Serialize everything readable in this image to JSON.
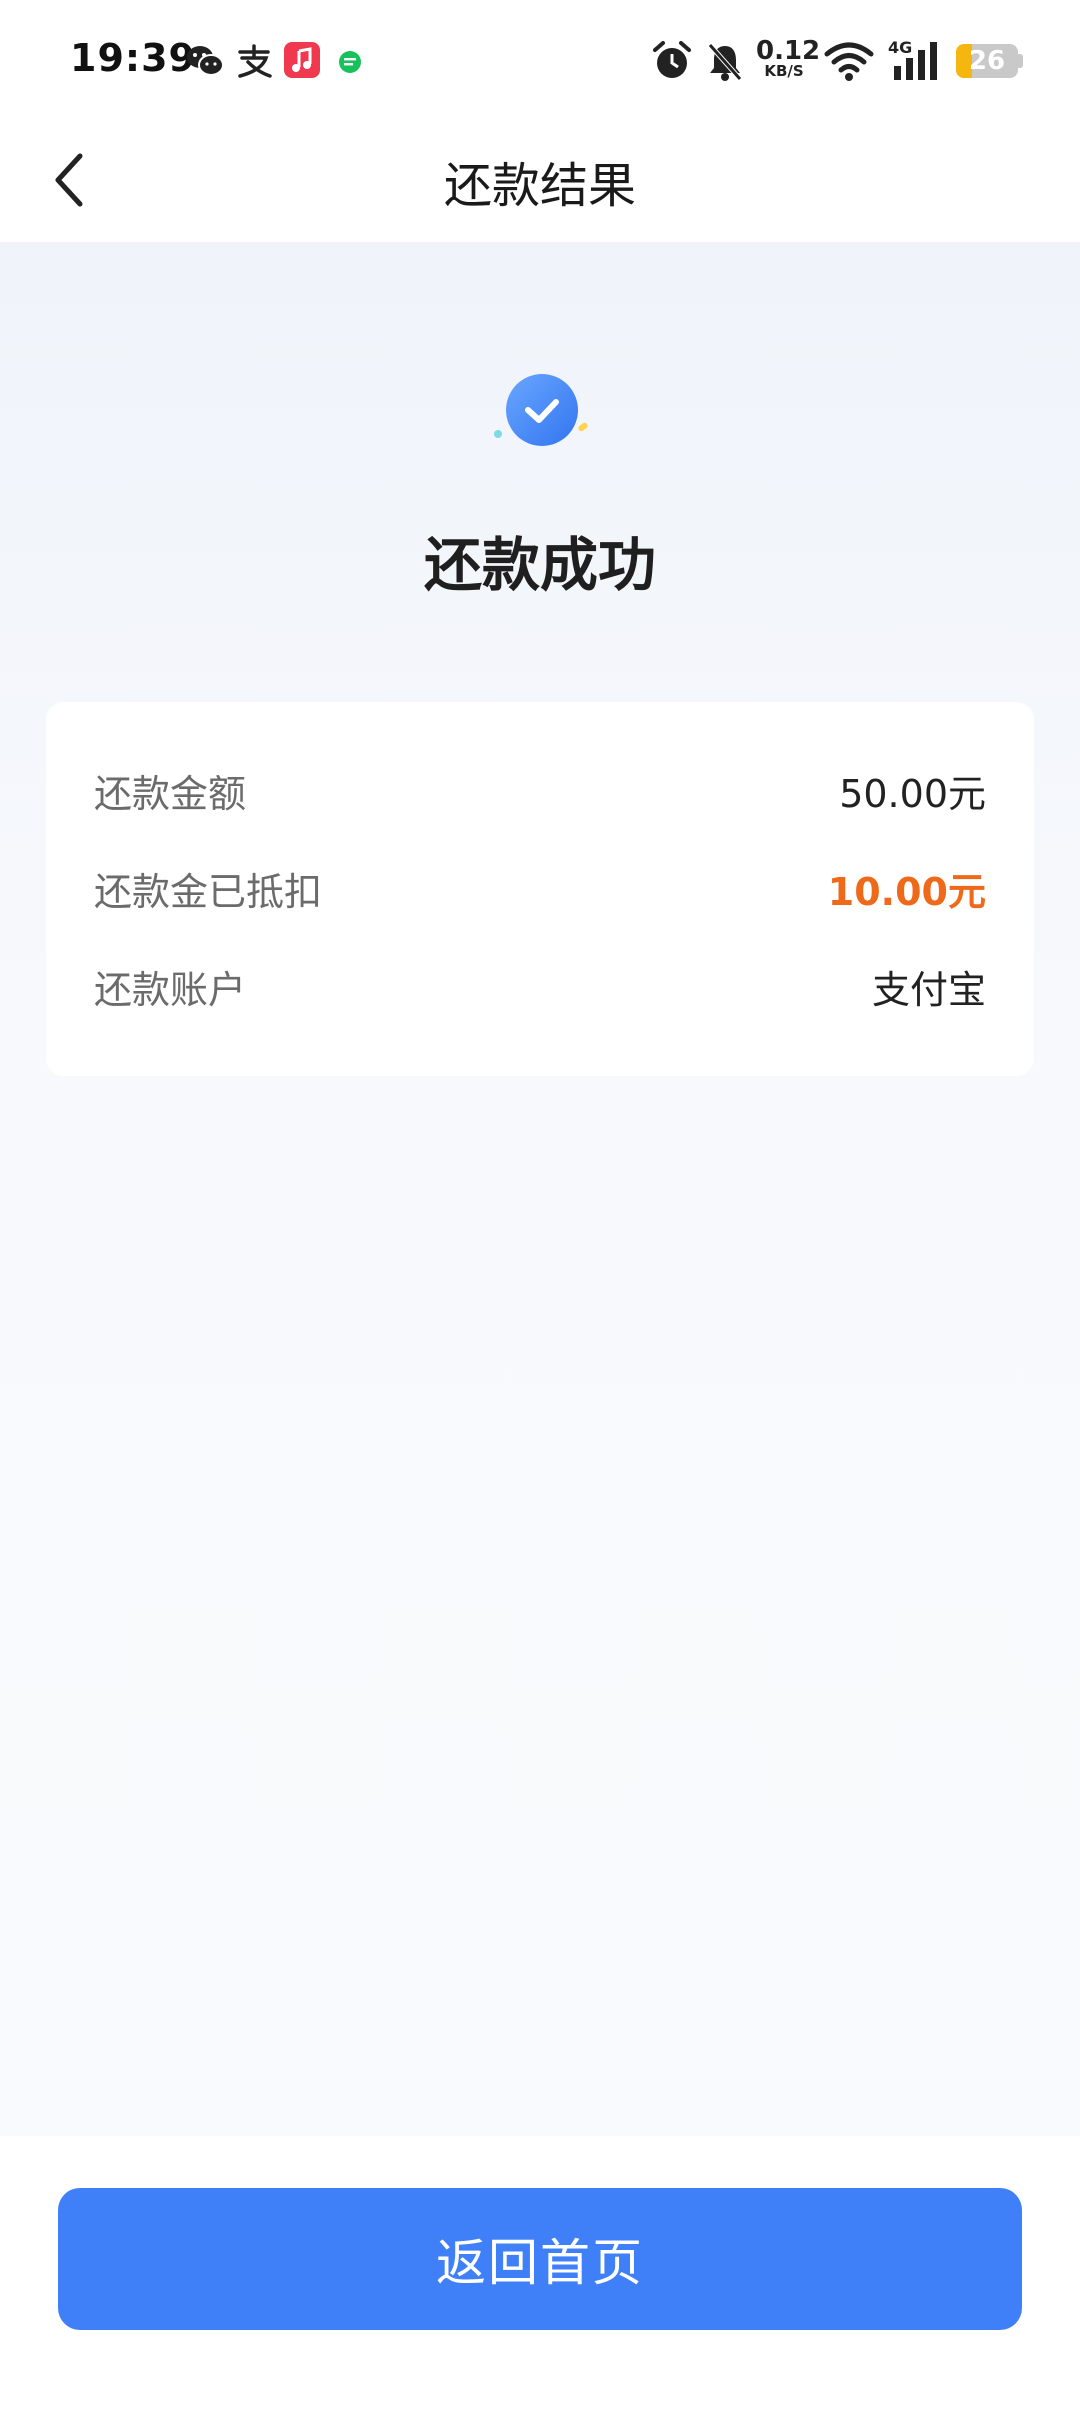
{
  "status_bar": {
    "time": "19:39",
    "net_speed_value": "0.12",
    "net_speed_unit": "KB/S",
    "network_type": "4G",
    "battery_level": "26",
    "notification_icons": [
      "wechat-icon",
      "alipay-icon",
      "music-icon",
      "message-icon"
    ],
    "system_icons": [
      "alarm-icon",
      "mute-bell-icon",
      "wifi-icon",
      "signal-icon",
      "battery-icon"
    ]
  },
  "nav": {
    "title": "还款结果",
    "back_icon": "chevron-left-icon"
  },
  "result": {
    "status_text": "还款成功",
    "icon": "check-circle-icon"
  },
  "details": [
    {
      "label": "还款金额",
      "value": "50.00元",
      "highlight": false
    },
    {
      "label": "还款金已抵扣",
      "value": "10.00元",
      "highlight": true
    },
    {
      "label": "还款账户",
      "value": "支付宝",
      "highlight": false
    }
  ],
  "footer": {
    "home_button_label": "返回首页"
  },
  "colors": {
    "accent_blue": "#3f80f9",
    "highlight_orange": "#ee6a1a"
  }
}
